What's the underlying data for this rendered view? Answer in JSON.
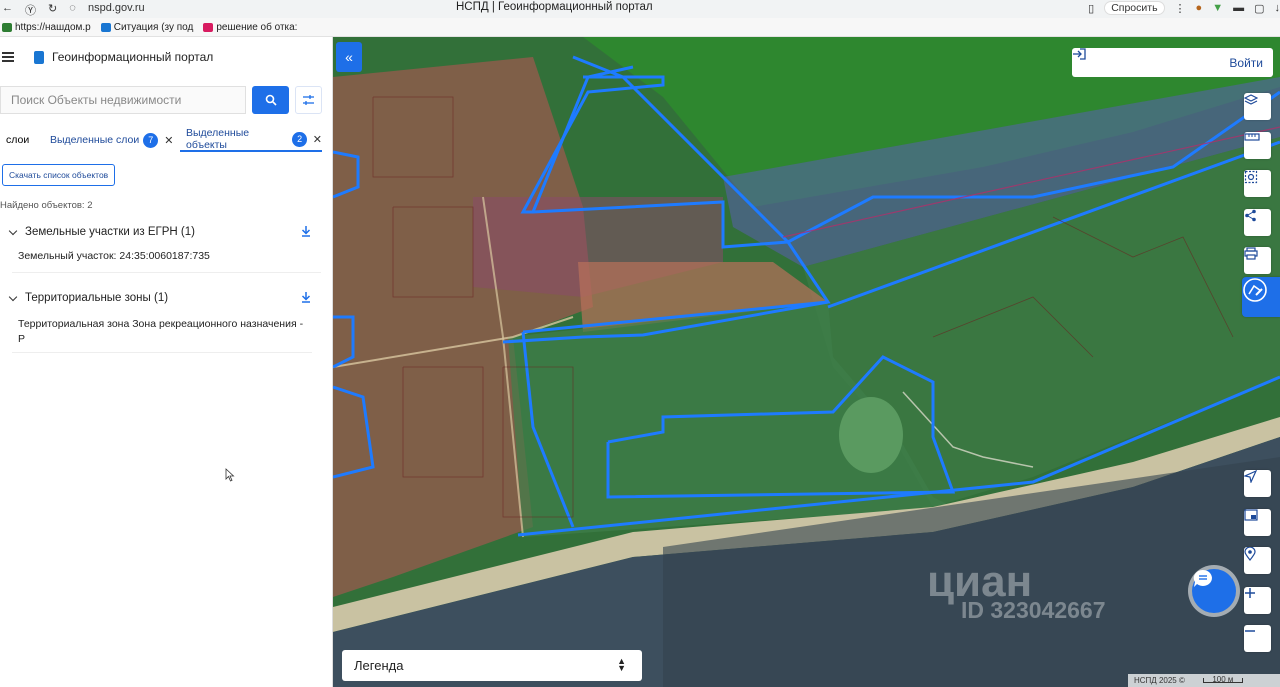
{
  "browser": {
    "url": "nspd.gov.ru",
    "tab_title": "НСПД | Геоинформационный портал",
    "ask_button": "Спросить"
  },
  "bookmarks": [
    {
      "label": "https://нашдом.р",
      "color": "#2e7d32"
    },
    {
      "label": "Ситуация (зу под",
      "color": "#1976d2"
    },
    {
      "label": "решение об отка:",
      "color": "#d81b60"
    }
  ],
  "header": {
    "title": "Геоинформационный портал"
  },
  "search": {
    "placeholder": "Поиск Объекты недвижимости"
  },
  "tabs": {
    "layers": "слои",
    "selected_layers": "Выделенные слои",
    "selected_layers_count": "7",
    "selected_objects": "Выделенные объекты",
    "selected_objects_count": "2"
  },
  "download_list_button": "Скачать список объектов",
  "found_text": "Найдено объектов: 2",
  "groups": [
    {
      "title": "Земельные участки из ЕГРН (1)",
      "items": [
        "Земельный участок: 24:35:0060187:735"
      ]
    },
    {
      "title": "Территориальные зоны (1)",
      "items": [
        "Территориальная зона Зона рекреационного назначения - Р"
      ]
    }
  ],
  "map": {
    "login_button": "Войти",
    "legend_label": "Легенда",
    "watermark": "циан",
    "watermark_id": "ID 323042667",
    "attribution": "НСПД 2025 ©",
    "scale_label": "100 м"
  },
  "colors": {
    "accent": "#1e6fe8",
    "boundary": "#1e7bff",
    "water": "#3d4f5e"
  }
}
